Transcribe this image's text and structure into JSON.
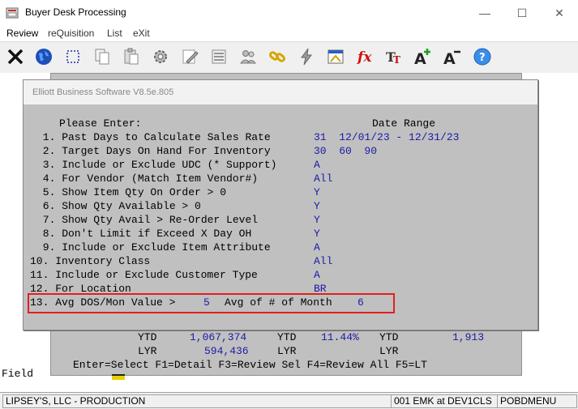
{
  "window": {
    "title": "Buyer Desk Processing",
    "controls": [
      "—",
      "☐",
      "✕"
    ]
  },
  "menu": [
    "Review",
    "reQuisition",
    "List",
    "eXit"
  ],
  "toolbar": [
    "close-x-icon",
    "globe-icon",
    "select-rect-icon",
    "copy-icon",
    "paste-icon",
    "settings-icon",
    "edit-icon",
    "list-icon",
    "users-icon",
    "link-chain-icon",
    "lightning-icon",
    "calculator-window-icon",
    "function-fx-icon",
    "font-tt-icon",
    "font-grow-icon",
    "font-shrink-icon",
    "help-icon"
  ],
  "dialog": {
    "title": "Elliott Business Software V8.5e.805",
    "header_left": "Please Enter:",
    "header_right": "Date Range",
    "rows": [
      {
        "label": " 1. Past Days to Calculate Sales Rate",
        "value": "31  12/01/23 - 12/31/23"
      },
      {
        "label": " 2. Target Days On Hand For Inventory",
        "value": "30  60  90"
      },
      {
        "label": " 3. Include or Exclude UDC (* Support)",
        "value": "A"
      },
      {
        "label": " 4. For Vendor (Match Item Vendor#)",
        "value": "All"
      },
      {
        "label": " 5. Show Item Qty On Order > 0",
        "value": "Y"
      },
      {
        "label": " 6. Show Qty Available > 0",
        "value": "Y"
      },
      {
        "label": " 7. Show Qty Avail > Re-Order Level",
        "value": "Y"
      },
      {
        "label": " 8. Don't Limit if Exceed X Day OH",
        "value": "Y"
      },
      {
        "label": " 9. Include or Exclude Item Attribute",
        "value": "A"
      },
      {
        "label": "10. Inventory Class",
        "value": "All"
      },
      {
        "label": "11. Include or Exclude Customer Type",
        "value": "A"
      },
      {
        "label": "12. For Location",
        "value": "BR"
      }
    ],
    "row13": {
      "label": "13. Avg DOS/Mon Value >",
      "value1": "5",
      "mid": "Avg of # of Month",
      "value2": "6"
    }
  },
  "back": {
    "ytd_label": "YTD",
    "ytd1": "1,067,374",
    "ytd2": "11.44%",
    "ytd3": "1,913",
    "lyr_label": "LYR",
    "lyr1": "594,436",
    "keys": "Enter=Select F1=Detail F3=Review Sel F4=Review All F5=LT"
  },
  "field_label": "Field",
  "status": {
    "company": "LIPSEY'S, LLC - PRODUCTION",
    "session": "001 EMK at DEV1CLS",
    "menu": "POBDMENU"
  }
}
